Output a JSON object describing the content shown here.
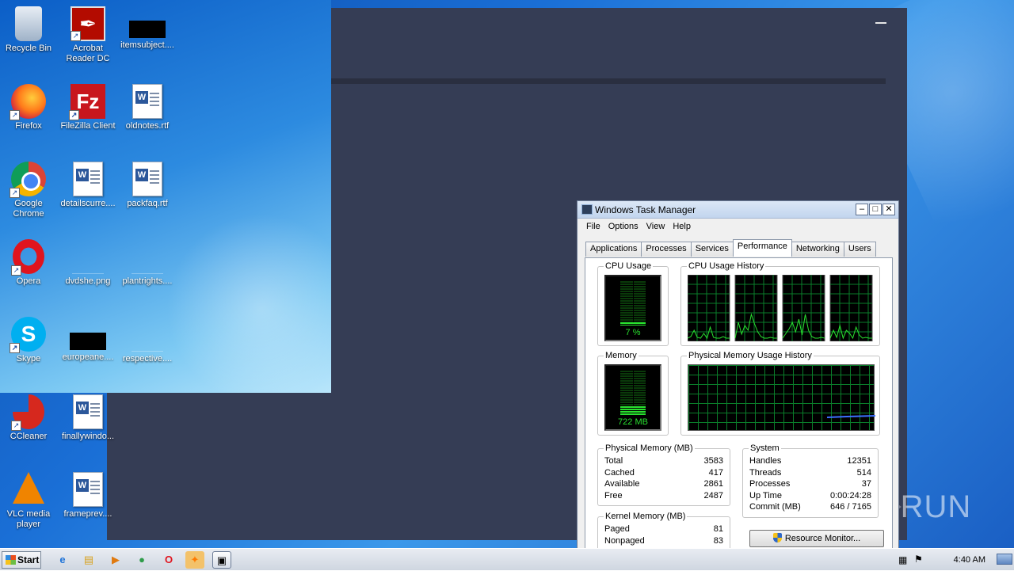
{
  "desktop_icons": [
    {
      "label": "Recycle Bin",
      "icon": "recycle-bin-icon"
    },
    {
      "label": "Acrobat Reader DC",
      "icon": "acrobat-icon"
    },
    {
      "label": "itemsubject....",
      "icon": "image-file-icon"
    },
    {
      "label": "Firefox",
      "icon": "firefox-icon"
    },
    {
      "label": "FileZilla Client",
      "icon": "filezilla-icon"
    },
    {
      "label": "oldnotes.rtf",
      "icon": "word-doc-icon"
    },
    {
      "label": "Google Chrome",
      "icon": "chrome-icon"
    },
    {
      "label": "detailscurre....",
      "icon": "word-doc-icon"
    },
    {
      "label": "packfaq.rtf",
      "icon": "word-doc-icon"
    },
    {
      "label": "Opera",
      "icon": "opera-icon"
    },
    {
      "label": "dvdshe.png",
      "icon": "image-file-icon"
    },
    {
      "label": "plantrights....",
      "icon": "image-file-icon"
    },
    {
      "label": "Skype",
      "icon": "skype-icon"
    },
    {
      "label": "europeane....",
      "icon": "image-file-icon"
    },
    {
      "label": "respective....",
      "icon": "image-file-icon"
    },
    {
      "label": "CCleaner",
      "icon": "ccleaner-icon"
    },
    {
      "label": "finallywindo...",
      "icon": "word-doc-icon"
    },
    {
      "label": "VLC media player",
      "icon": "vlc-icon"
    },
    {
      "label": "frameprev....",
      "icon": "word-doc-icon"
    }
  ],
  "task_manager": {
    "title": "Windows Task Manager",
    "menu": [
      "File",
      "Options",
      "View",
      "Help"
    ],
    "tabs": [
      "Applications",
      "Processes",
      "Services",
      "Performance",
      "Networking",
      "Users"
    ],
    "active_tab": "Performance",
    "cpu_usage": {
      "title": "CPU Usage",
      "value": "7 %",
      "level": 0.07
    },
    "cpu_history": {
      "title": "CPU Usage History"
    },
    "memory": {
      "title": "Memory",
      "value": "722 MB",
      "level": 0.2
    },
    "memory_history": {
      "title": "Physical Memory Usage History"
    },
    "physical_memory": {
      "title": "Physical Memory (MB)",
      "rows": [
        {
          "label": "Total",
          "value": "3583"
        },
        {
          "label": "Cached",
          "value": "417"
        },
        {
          "label": "Available",
          "value": "2861"
        },
        {
          "label": "Free",
          "value": "2487"
        }
      ]
    },
    "kernel_memory": {
      "title": "Kernel Memory (MB)",
      "rows": [
        {
          "label": "Paged",
          "value": "81"
        },
        {
          "label": "Nonpaged",
          "value": "83"
        }
      ]
    },
    "system": {
      "title": "System",
      "rows": [
        {
          "label": "Handles",
          "value": "12351"
        },
        {
          "label": "Threads",
          "value": "514"
        },
        {
          "label": "Processes",
          "value": "37"
        },
        {
          "label": "Up Time",
          "value": "0:00:24:28"
        },
        {
          "label": "Commit (MB)",
          "value": "646 / 7165"
        }
      ]
    },
    "resource_monitor_label": "Resource Monitor..."
  },
  "taskbar": {
    "start_label": "Start",
    "clock": "4:40 AM",
    "pinned": [
      "ie-icon",
      "explorer-icon",
      "media-player-icon",
      "chrome-icon",
      "opera-icon",
      "avast-icon",
      "task-manager-icon"
    ]
  },
  "watermark": "ANY RUN"
}
